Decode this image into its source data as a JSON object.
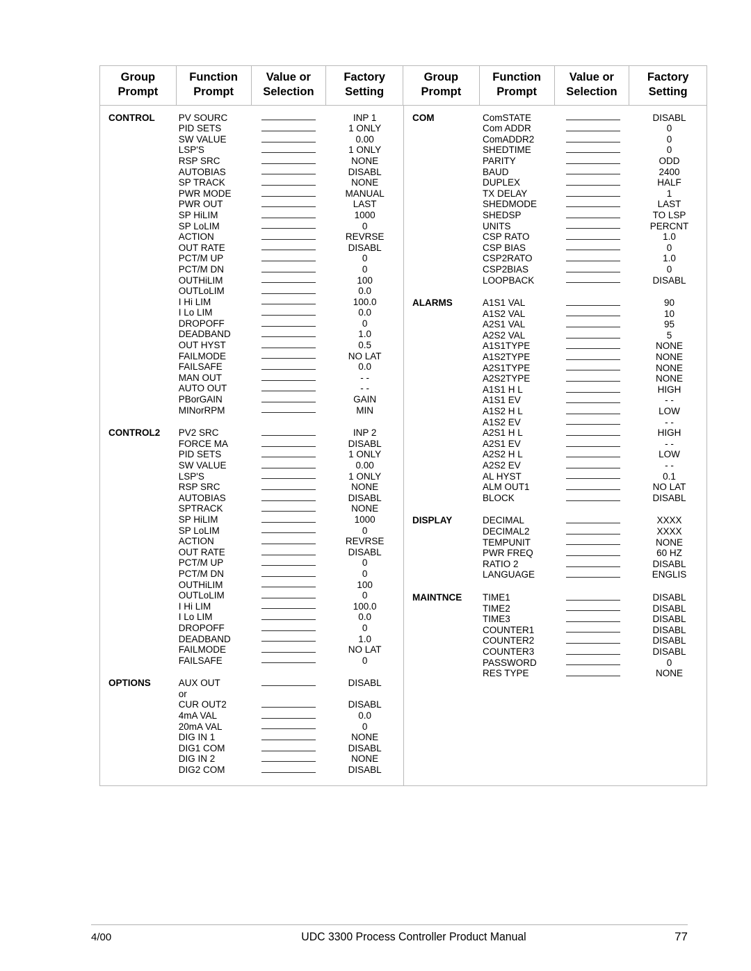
{
  "table": {
    "headers": [
      {
        "line1": "Group",
        "line2": "Prompt"
      },
      {
        "line1": "Function",
        "line2": "Prompt"
      },
      {
        "line1": "Value or",
        "line2": "Selection"
      },
      {
        "line1": "Factory",
        "line2": "Setting"
      },
      {
        "line1": "Group",
        "line2": "Prompt"
      },
      {
        "line1": "Function",
        "line2": "Prompt"
      },
      {
        "line1": "Value or",
        "line2": "Selection"
      },
      {
        "line1": "Factory",
        "line2": "Setting"
      }
    ],
    "left_column": [
      {
        "group": "CONTROL",
        "rows": [
          {
            "function": "PV SOURC",
            "value": "",
            "factory": "INP 1"
          },
          {
            "function": "PID SETS",
            "value": "",
            "factory": "1 ONLY"
          },
          {
            "function": "SW VALUE",
            "value": "",
            "factory": "0.00"
          },
          {
            "function": "LSP'S",
            "value": "",
            "factory": "1 ONLY"
          },
          {
            "function": "RSP SRC",
            "value": "",
            "factory": "NONE"
          },
          {
            "function": "AUTOBIAS",
            "value": "",
            "factory": "DISABL"
          },
          {
            "function": "SP TRACK",
            "value": "",
            "factory": "NONE"
          },
          {
            "function": "PWR MODE",
            "value": "",
            "factory": "MANUAL"
          },
          {
            "function": "PWR OUT",
            "value": "",
            "factory": "LAST"
          },
          {
            "function": "SP HiLIM",
            "value": "",
            "factory": "1000"
          },
          {
            "function": "SP LoLIM",
            "value": "",
            "factory": "0"
          },
          {
            "function": "ACTION",
            "value": "",
            "factory": "REVRSE"
          },
          {
            "function": "OUT RATE",
            "value": "",
            "factory": "DISABL"
          },
          {
            "function": "PCT/M UP",
            "value": "",
            "factory": "0"
          },
          {
            "function": "PCT/M DN",
            "value": "",
            "factory": "0"
          },
          {
            "function": "OUTHiLIM",
            "value": "",
            "factory": "100"
          },
          {
            "function": "OUTLoLIM",
            "value": "",
            "factory": "0.0"
          },
          {
            "function": "I Hi LIM",
            "value": "",
            "factory": "100.0"
          },
          {
            "function": "I Lo LIM",
            "value": "",
            "factory": "0.0"
          },
          {
            "function": "DROPOFF",
            "value": "",
            "factory": "0"
          },
          {
            "function": "DEADBAND",
            "value": "",
            "factory": "1.0"
          },
          {
            "function": "OUT HYST",
            "value": "",
            "factory": "0.5"
          },
          {
            "function": "FAILMODE",
            "value": "",
            "factory": "NO LAT"
          },
          {
            "function": "FAILSAFE",
            "value": "",
            "factory": "0.0"
          },
          {
            "function": "MAN OUT",
            "value": "",
            "factory": "- -"
          },
          {
            "function": "AUTO OUT",
            "value": "",
            "factory": "- -"
          },
          {
            "function": "PBorGAIN",
            "value": "",
            "factory": "GAIN"
          },
          {
            "function": "MINorRPM",
            "value": "",
            "factory": "MIN"
          }
        ]
      },
      {
        "group": "CONTROL2",
        "rows": [
          {
            "function": "PV2 SRC",
            "value": "",
            "factory": "INP 2"
          },
          {
            "function": "FORCE MA",
            "value": "",
            "factory": "DISABL"
          },
          {
            "function": "PID SETS",
            "value": "",
            "factory": "1 ONLY"
          },
          {
            "function": "SW VALUE",
            "value": "",
            "factory": "0.00"
          },
          {
            "function": "LSP'S",
            "value": "",
            "factory": "1 ONLY"
          },
          {
            "function": "RSP SRC",
            "value": "",
            "factory": "NONE"
          },
          {
            "function": "AUTOBIAS",
            "value": "",
            "factory": "DISABL"
          },
          {
            "function": "SPTRACK",
            "value": "",
            "factory": "NONE"
          },
          {
            "function": "SP HiLIM",
            "value": "",
            "factory": "1000"
          },
          {
            "function": "SP LoLIM",
            "value": "",
            "factory": "0"
          },
          {
            "function": "ACTION",
            "value": "",
            "factory": "REVRSE"
          },
          {
            "function": "OUT RATE",
            "value": "",
            "factory": "DISABL"
          },
          {
            "function": "PCT/M UP",
            "value": "",
            "factory": "0"
          },
          {
            "function": "PCT/M DN",
            "value": "",
            "factory": "0"
          },
          {
            "function": "OUTHiLIM",
            "value": "",
            "factory": "100"
          },
          {
            "function": "OUTLoLIM",
            "value": "",
            "factory": "0"
          },
          {
            "function": "I Hi LIM",
            "value": "",
            "factory": "100.0"
          },
          {
            "function": "I Lo LIM",
            "value": "",
            "factory": "0.0"
          },
          {
            "function": "DROPOFF",
            "value": "",
            "factory": "0"
          },
          {
            "function": "DEADBAND",
            "value": "",
            "factory": "1.0"
          },
          {
            "function": "FAILMODE",
            "value": "",
            "factory": "NO LAT"
          },
          {
            "function": "FAILSAFE",
            "value": "",
            "factory": "0"
          }
        ]
      },
      {
        "group": "OPTIONS",
        "rows": [
          {
            "function": "AUX OUT",
            "value": "",
            "factory": "DISABL"
          },
          {
            "function": "or",
            "value": null,
            "factory": "",
            "separator": true
          },
          {
            "function": "CUR OUT2",
            "value": "",
            "factory": "DISABL"
          },
          {
            "function": "4mA VAL",
            "value": "",
            "factory": "0.0"
          },
          {
            "function": "20mA VAL",
            "value": "",
            "factory": "0"
          },
          {
            "function": "DIG IN 1",
            "value": "",
            "factory": "NONE"
          },
          {
            "function": "DIG1 COM",
            "value": "",
            "factory": "DISABL"
          },
          {
            "function": "DIG IN 2",
            "value": "",
            "factory": "NONE"
          },
          {
            "function": "DIG2 COM",
            "value": "",
            "factory": "DISABL"
          }
        ]
      }
    ],
    "right_column": [
      {
        "group": "COM",
        "rows": [
          {
            "function": "ComSTATE",
            "value": "",
            "factory": "DISABL"
          },
          {
            "function": "Com ADDR",
            "value": "",
            "factory": "0"
          },
          {
            "function": "ComADDR2",
            "value": "",
            "factory": "0"
          },
          {
            "function": "SHEDTIME",
            "value": "",
            "factory": "0"
          },
          {
            "function": "PARITY",
            "value": "",
            "factory": "ODD"
          },
          {
            "function": "BAUD",
            "value": "",
            "factory": "2400"
          },
          {
            "function": "DUPLEX",
            "value": "",
            "factory": "HALF"
          },
          {
            "function": "TX DELAY",
            "value": "",
            "factory": "1"
          },
          {
            "function": "SHEDMODE",
            "value": "",
            "factory": "LAST"
          },
          {
            "function": "SHEDSP",
            "value": "",
            "factory": "TO LSP"
          },
          {
            "function": "UNITS",
            "value": "",
            "factory": "PERCNT"
          },
          {
            "function": "CSP RATO",
            "value": "",
            "factory": "1.0"
          },
          {
            "function": "CSP BIAS",
            "value": "",
            "factory": "0"
          },
          {
            "function": "CSP2RATO",
            "value": "",
            "factory": "1.0"
          },
          {
            "function": "CSP2BIAS",
            "value": "",
            "factory": "0"
          },
          {
            "function": "LOOPBACK",
            "value": "",
            "factory": "DISABL"
          }
        ]
      },
      {
        "group": "ALARMS",
        "rows": [
          {
            "function": "A1S1 VAL",
            "value": "",
            "factory": "90"
          },
          {
            "function": "A1S2 VAL",
            "value": "",
            "factory": "10"
          },
          {
            "function": "A2S1 VAL",
            "value": "",
            "factory": "95"
          },
          {
            "function": "A2S2 VAL",
            "value": "",
            "factory": "5"
          },
          {
            "function": "A1S1TYPE",
            "value": "",
            "factory": "NONE"
          },
          {
            "function": "A1S2TYPE",
            "value": "",
            "factory": "NONE"
          },
          {
            "function": "A2S1TYPE",
            "value": "",
            "factory": "NONE"
          },
          {
            "function": "A2S2TYPE",
            "value": "",
            "factory": "NONE"
          },
          {
            "function": "A1S1 H L",
            "value": "",
            "factory": "HIGH"
          },
          {
            "function": "A1S1 EV",
            "value": "",
            "factory": "- -"
          },
          {
            "function": "A1S2 H L",
            "value": "",
            "factory": "LOW"
          },
          {
            "function": "A1S2 EV",
            "value": "",
            "factory": "- -"
          },
          {
            "function": "A2S1 H L",
            "value": "",
            "factory": "HIGH"
          },
          {
            "function": "A2S1 EV",
            "value": "",
            "factory": "- -"
          },
          {
            "function": "A2S2 H L",
            "value": "",
            "factory": "LOW"
          },
          {
            "function": "A2S2 EV",
            "value": "",
            "factory": "- -"
          },
          {
            "function": "AL HYST",
            "value": "",
            "factory": "0.1"
          },
          {
            "function": "ALM OUT1",
            "value": "",
            "factory": "NO LAT"
          },
          {
            "function": "BLOCK",
            "value": "",
            "factory": "DISABL"
          }
        ]
      },
      {
        "group": "DISPLAY",
        "rows": [
          {
            "function": "DECIMAL",
            "value": "",
            "factory": "XXXX"
          },
          {
            "function": "DECIMAL2",
            "value": "",
            "factory": "XXXX"
          },
          {
            "function": "TEMPUNIT",
            "value": "",
            "factory": "NONE"
          },
          {
            "function": "PWR FREQ",
            "value": "",
            "factory": "60 HZ"
          },
          {
            "function": "RATIO 2",
            "value": "",
            "factory": "DISABL"
          },
          {
            "function": "LANGUAGE",
            "value": "",
            "factory": "ENGLIS"
          }
        ]
      },
      {
        "group": "MAINTNCE",
        "rows": [
          {
            "function": "TIME1",
            "value": "",
            "factory": "DISABL"
          },
          {
            "function": "TIME2",
            "value": "",
            "factory": "DISABL"
          },
          {
            "function": "TIME3",
            "value": "",
            "factory": "DISABL"
          },
          {
            "function": "COUNTER1",
            "value": "",
            "factory": "DISABL"
          },
          {
            "function": "COUNTER2",
            "value": "",
            "factory": "DISABL"
          },
          {
            "function": "COUNTER3",
            "value": "",
            "factory": "DISABL"
          },
          {
            "function": "PASSWORD",
            "value": "",
            "factory": "0"
          },
          {
            "function": "RES TYPE",
            "value": "",
            "factory": "NONE"
          }
        ]
      }
    ]
  },
  "footer": {
    "date": "4/00",
    "title": "UDC 3300 Process Controller Product Manual",
    "page_number": "77"
  }
}
